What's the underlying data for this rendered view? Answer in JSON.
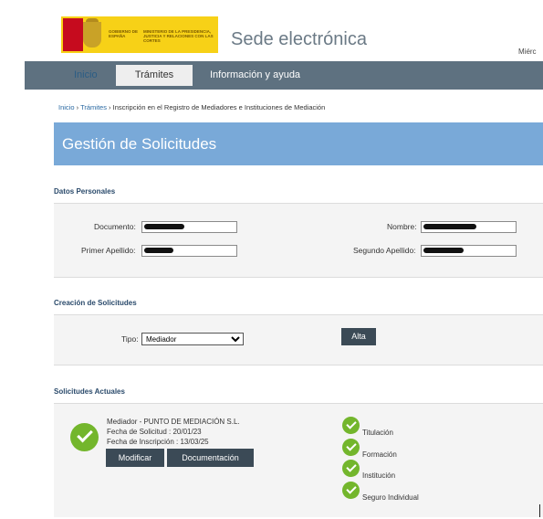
{
  "header": {
    "logo_left": "GOBIERNO DE ESPAÑA",
    "logo_right": "MINISTERIO DE LA PRESIDENCIA, JUSTICIA Y RELACIONES CON LAS CORTES",
    "site_title": "Sede electrónica",
    "date_stub": "Miérc"
  },
  "nav": {
    "inicio": "Inicio",
    "tramites": "Trámites",
    "info": "Información y ayuda"
  },
  "breadcrumb": {
    "inicio": "Inicio",
    "tramites": "Trámites",
    "current": "Inscripción en el Registro de Mediadores e Instituciones de Mediación"
  },
  "page_title": "Gestión de Solicitudes",
  "personal": {
    "title": "Datos Personales",
    "documento_label": "Documento:",
    "nombre_label": "Nombre:",
    "apellido1_label": "Primer Apellido:",
    "apellido2_label": "Segundo Apellido:"
  },
  "creacion": {
    "title": "Creación de Solicitudes",
    "tipo_label": "Tipo:",
    "tipo_value": "Mediador",
    "alta_button": "Alta"
  },
  "actuales": {
    "title": "Solicitudes Actuales",
    "tipo_nombre": "Mediador - PUNTO DE MEDIACIÓN S.L.",
    "fecha_solicitud": "Fecha de Solicitud : 20/01/23",
    "fecha_inscripcion": "Fecha de Inscripción : 13/03/25",
    "modificar_button": "Modificar",
    "documentacion_button": "Documentación",
    "conditions": [
      "Titulación",
      "Formación",
      "Institución",
      "Seguro Individual"
    ]
  },
  "colors": {
    "nav_bg": "#5e7180",
    "title_band": "#79a9d8",
    "check_green": "#73b62c",
    "button_dark": "#3b4a56"
  }
}
